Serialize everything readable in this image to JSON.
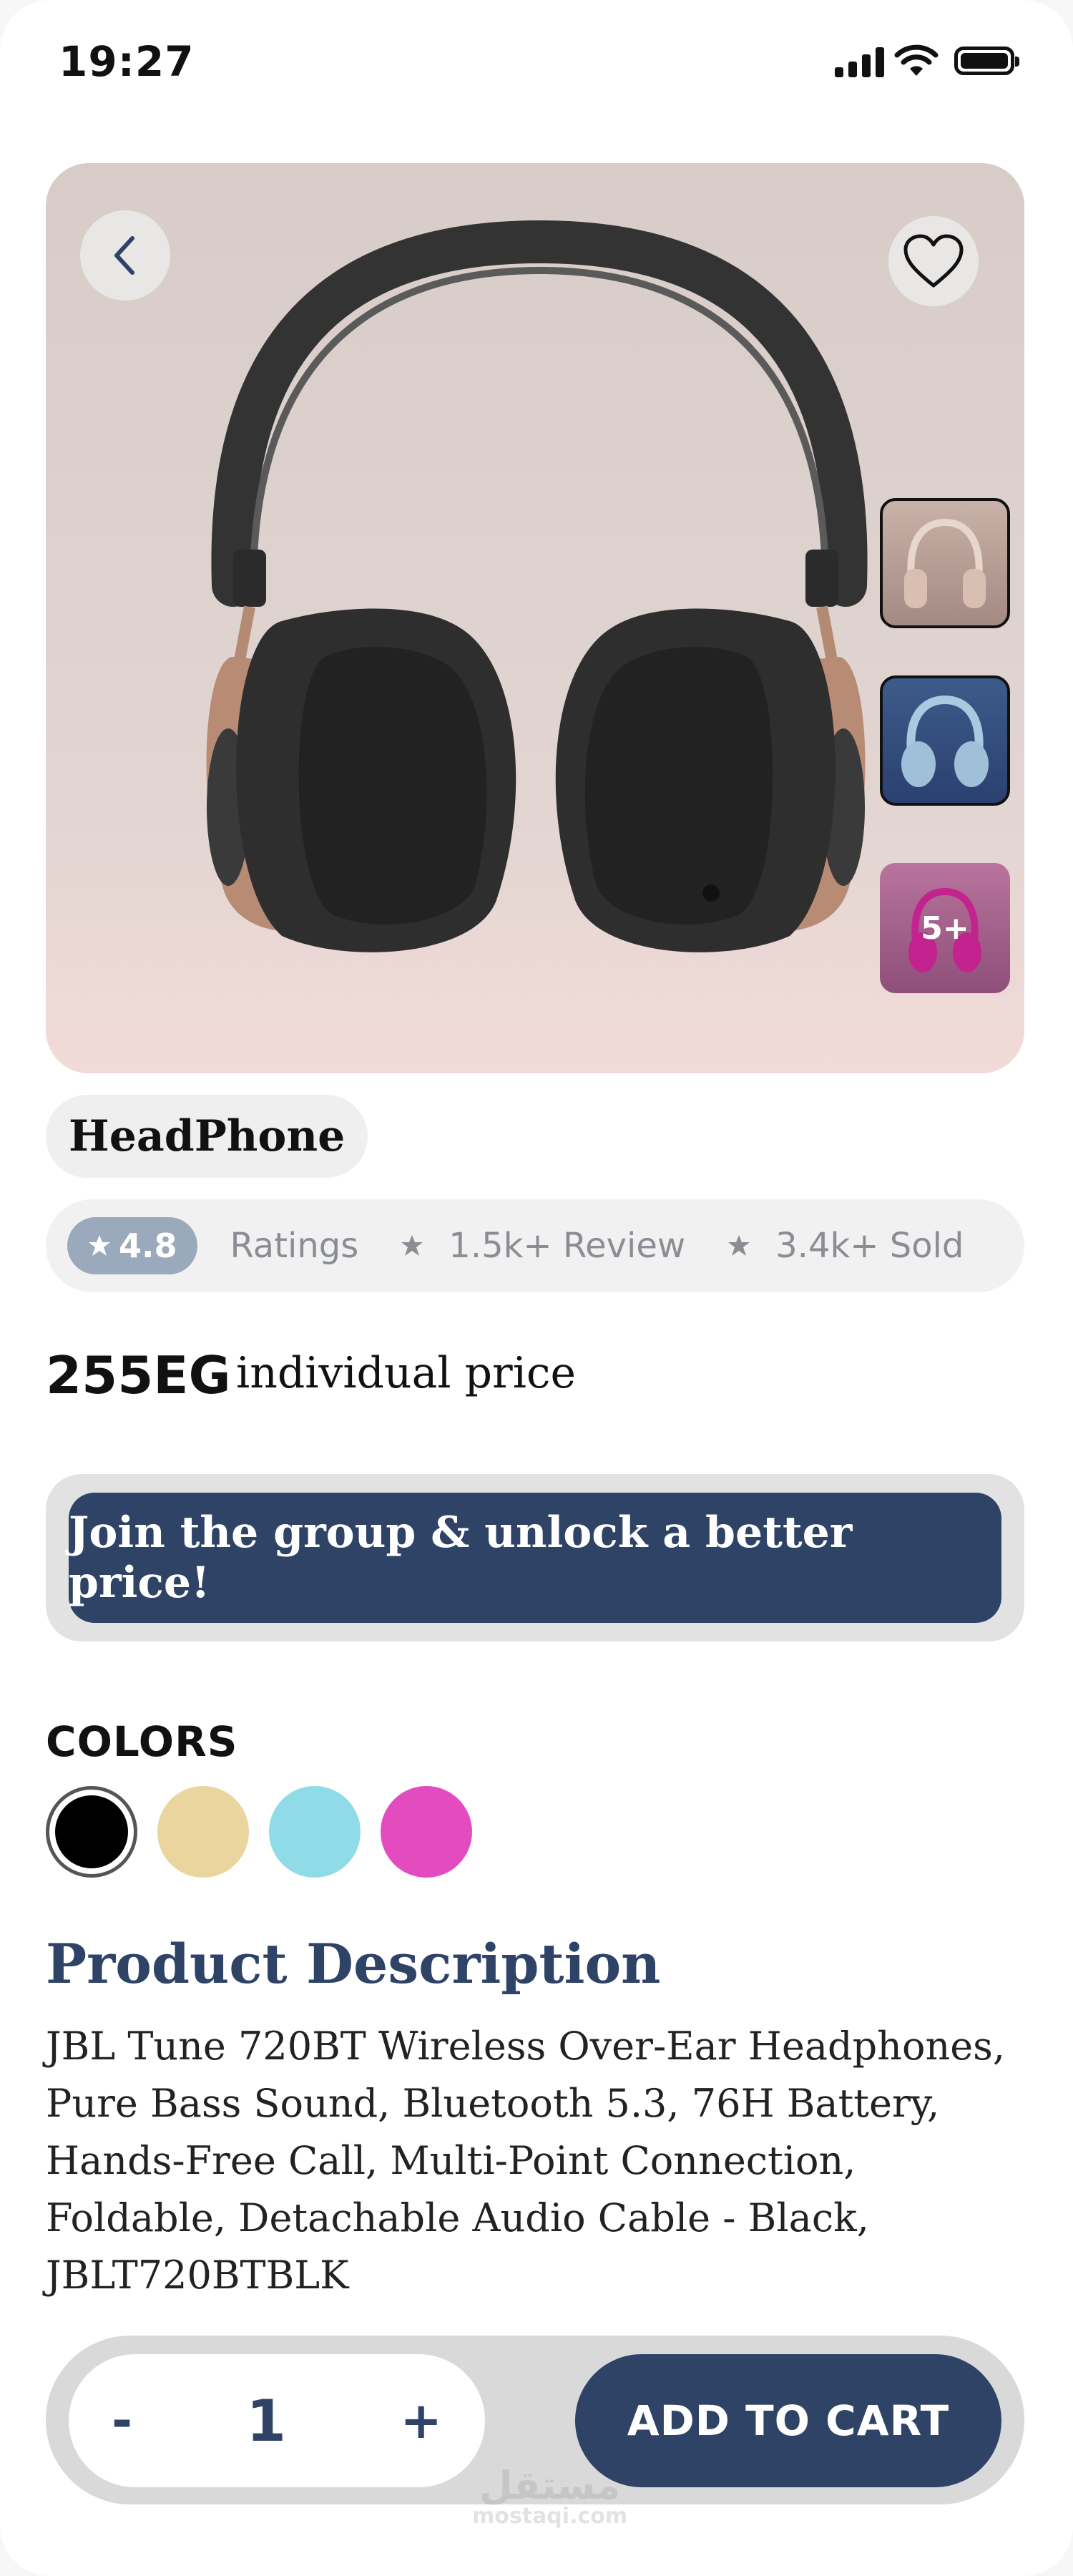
{
  "status_bar": {
    "time": "19:27"
  },
  "product": {
    "title": "HeadPhone",
    "rating": "4.8",
    "ratings_label": "Ratings",
    "reviews": "1.5k+ Review",
    "sold": "3.4k+ Sold",
    "price": "255EG",
    "price_label": "individual price",
    "more_images": "5+"
  },
  "group": {
    "label": "Join the group & unlock a better price!"
  },
  "colors": {
    "title": "COLORS",
    "swatches": [
      "#000000",
      "#ead59e",
      "#8fdce8",
      "#e34cbf"
    ],
    "selected_index": 0
  },
  "description": {
    "title": "Product Description",
    "body": "JBL Tune 720BT Wireless Over-Ear Headphones, Pure Bass Sound, Bluetooth 5.3, 76H Battery, Hands-Free Call, Multi-Point Connection, Foldable, Detachable Audio Cable - Black, JBLT720BTBLK"
  },
  "cart": {
    "minus": "-",
    "quantity": "1",
    "plus": "+",
    "add_label": "ADD TO CART"
  },
  "watermark": {
    "arabic": "مستقل",
    "latin": "mostaqi.com"
  },
  "theme": {
    "accent": "#2e4366",
    "rating_badge": "#9aa9bb"
  }
}
